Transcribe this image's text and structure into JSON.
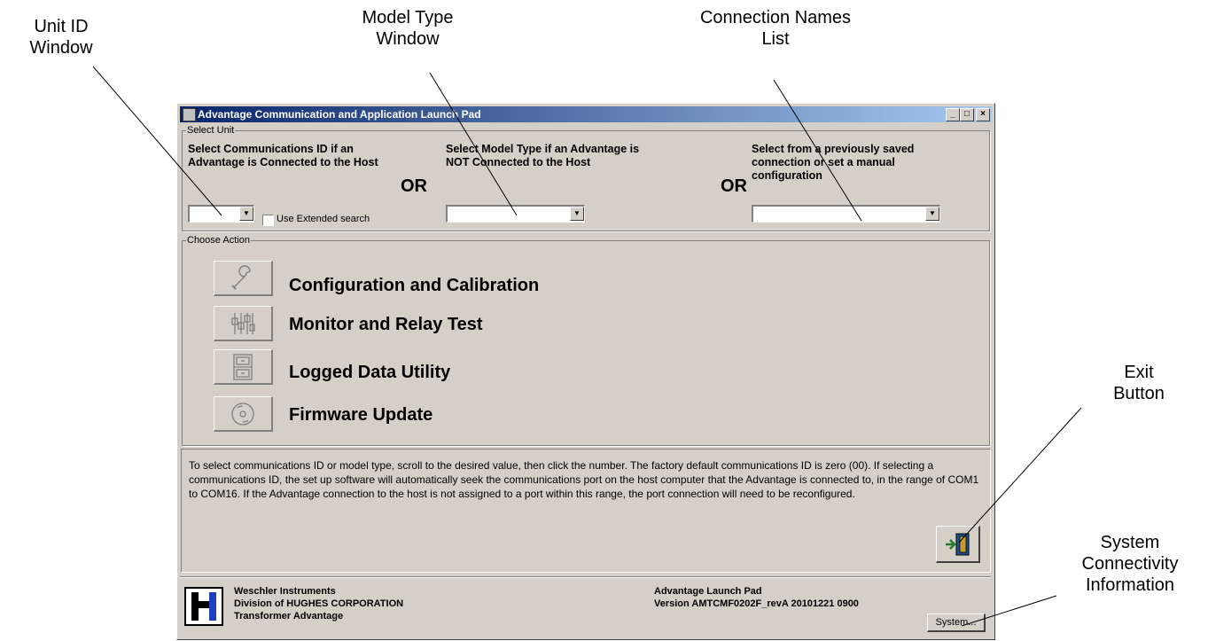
{
  "callouts": {
    "unit_id": [
      "Unit ID",
      "Window"
    ],
    "model_type": [
      "Model Type",
      "Window"
    ],
    "connection_names": [
      "Connection Names",
      "List"
    ],
    "exit_button": [
      "Exit",
      "Button"
    ],
    "system_info": [
      "System",
      "Connectivity",
      "Information"
    ]
  },
  "window": {
    "title": "Advantage Communication and Application Launch Pad",
    "controls": {
      "minimize": "_",
      "maximize": "□",
      "close": "×"
    }
  },
  "select_unit": {
    "legend": "Select Unit",
    "comm_id_instruction": "Select Communications ID if an Advantage is Connected to the Host",
    "or_label": "OR",
    "extended_search_label": "Use Extended search",
    "extended_search_checked": false,
    "model_type_instruction": "Select Model Type if an Advantage is NOT Connected to the Host",
    "connection_instruction": "Select from a previously saved connection or set a manual configuration",
    "comm_id_value": "",
    "model_type_value": "",
    "connection_value": ""
  },
  "choose_action": {
    "legend": "Choose Action",
    "actions": [
      {
        "label": "Configuration and Calibration",
        "icon": "wrench-icon"
      },
      {
        "label": "Monitor and Relay Test",
        "icon": "relay-test-icon"
      },
      {
        "label": "Logged Data Utility",
        "icon": "file-cabinet-icon"
      },
      {
        "label": "Firmware Update",
        "icon": "disc-icon"
      }
    ]
  },
  "help_text": "To select communications ID or model type, scroll to the desired value, then click the number. The factory default communications ID is zero (00). If selecting a communications ID, the set up software will automatically seek the communications port on the host computer that the Advantage is connected to, in the range of COM1 to COM16. If the Advantage connection to the host is not assigned to a port within this range, the port connection will need to be reconfigured.",
  "footer": {
    "company_lines": [
      "Weschler Instruments",
      "Division of HUGHES CORPORATION",
      "Transformer Advantage"
    ],
    "app_lines": [
      "Advantage Launch Pad",
      "Version AMTCMF0202F_revA  20101221 0900"
    ],
    "system_button": "System..."
  },
  "colors": {
    "title_start": "#0a246a",
    "title_end": "#a6caf0",
    "face": "#d4d0c8"
  }
}
